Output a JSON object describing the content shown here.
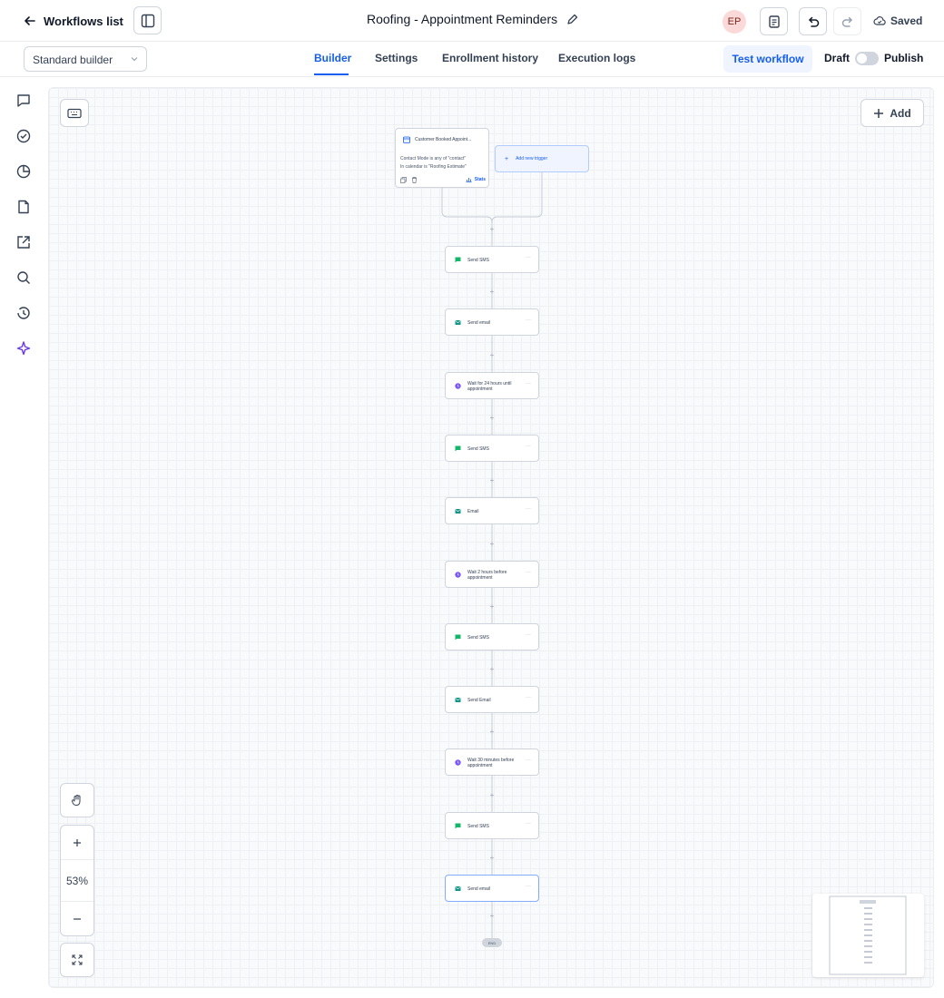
{
  "header": {
    "back_label": "Workflows list",
    "title": "Roofing - Appointment Reminders",
    "avatar_initials": "EP",
    "saved_label": "Saved"
  },
  "toolbar": {
    "builder_select": "Standard builder",
    "tabs": [
      {
        "label": "Builder",
        "active": true
      },
      {
        "label": "Settings",
        "active": false
      },
      {
        "label": "Enrollment history",
        "active": false
      },
      {
        "label": "Execution logs",
        "active": false
      }
    ],
    "test_label": "Test workflow",
    "draft_label": "Draft",
    "publish_label": "Publish",
    "published": false
  },
  "sidebar": {
    "icons": [
      "chat-icon",
      "check-circle-icon",
      "pie-chart-icon",
      "file-icon",
      "external-link-icon",
      "search-icon",
      "history-icon",
      "sparkle-icon"
    ]
  },
  "canvas": {
    "add_label": "Add",
    "zoom_label": "53%",
    "trigger": {
      "title": "Customer Booked Appoint...",
      "condition_line1": "Contact Mode is any of \"contact\"",
      "condition_line2": "In calendar is \"Roofing Estimate\"",
      "stats_label": "Stats"
    },
    "add_trigger_label": "Add new trigger",
    "end_label": "END",
    "nodes": [
      {
        "label": "Send SMS",
        "kind": "sms"
      },
      {
        "label": "Send email",
        "kind": "email"
      },
      {
        "label": "Wait for 24 hours until appointment",
        "kind": "wait"
      },
      {
        "label": "Send SMS",
        "kind": "sms"
      },
      {
        "label": "Email",
        "kind": "email"
      },
      {
        "label": "Wait 2 hours before appointment",
        "kind": "wait"
      },
      {
        "label": "Send SMS",
        "kind": "sms"
      },
      {
        "label": "Send Email",
        "kind": "email"
      },
      {
        "label": "Wait 30 minutes before appointment",
        "kind": "wait"
      },
      {
        "label": "Send SMS",
        "kind": "sms"
      },
      {
        "label": "Send email",
        "kind": "email"
      }
    ]
  },
  "colors": {
    "accent": "#155eef",
    "sms": "#12b76a",
    "email": "#0e9384",
    "wait": "#7a5af8"
  }
}
